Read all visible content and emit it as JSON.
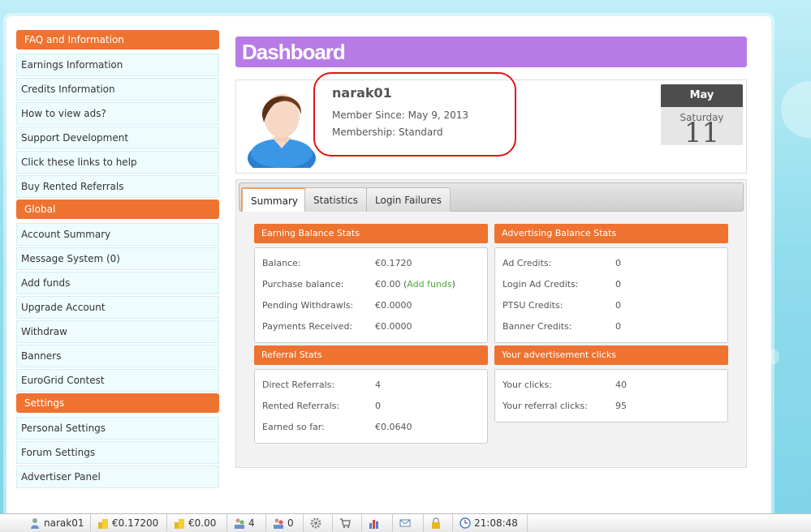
{
  "sidebar": {
    "faq_header": "FAQ and Information",
    "faq_items": [
      "Earnings Information",
      "Credits Information",
      "How to view ads?",
      "Support Development",
      "Click these links to help",
      "Buy Rented Referrals"
    ],
    "global_header": "Global",
    "global_items": [
      "Account Summary",
      "Message System (0)",
      "Add funds",
      "Upgrade Account",
      "Withdraw",
      "Banners",
      "EuroGrid Contest"
    ],
    "settings_header": "Settings",
    "settings_items": [
      "Personal Settings",
      "Forum Settings",
      "Advertiser Panel"
    ]
  },
  "dashboard": {
    "title": "Dashboard",
    "username": "narak01",
    "member_since": "Member Since: May 9, 2013",
    "membership": "Membership: Standard",
    "calendar": {
      "month": "May",
      "weekday": "Saturday",
      "day": "11"
    }
  },
  "tabs": [
    "Summary",
    "Statistics",
    "Login Failures"
  ],
  "earning": {
    "title": "Earning Balance Stats",
    "rows": [
      {
        "label": "Balance:",
        "value": "€0.1720"
      },
      {
        "label": "Purchase balance:",
        "value": "€0.00",
        "link": "Add funds"
      },
      {
        "label": "Pending Withdrawls:",
        "value": "€0.0000"
      },
      {
        "label": "Payments Received:",
        "value": "€0.0000"
      }
    ]
  },
  "advertising": {
    "title": "Advertising Balance Stats",
    "rows": [
      {
        "label": "Ad Credits:",
        "value": "0"
      },
      {
        "label": "Login Ad Credits:",
        "value": "0"
      },
      {
        "label": "PTSU Credits:",
        "value": "0"
      },
      {
        "label": "Banner Credits:",
        "value": "0"
      }
    ]
  },
  "referral": {
    "title": "Referral Stats",
    "rows": [
      {
        "label": "Direct Referrals:",
        "value": "4"
      },
      {
        "label": "Rented Referrals:",
        "value": "0"
      },
      {
        "label": "Earned so far:",
        "value": "€0.0640"
      }
    ]
  },
  "clicks": {
    "title": "Your advertisement clicks",
    "rows": [
      {
        "label": "Your clicks:",
        "value": "40"
      },
      {
        "label": "Your referral clicks:",
        "value": "95"
      }
    ]
  },
  "statusbar": {
    "user": "narak01",
    "balance": "€0.17200",
    "purchase": "€0.00",
    "direct": "4",
    "rented": "0",
    "time": "21:08:48"
  },
  "colors": {
    "orange": "#ee7330",
    "purple": "#b77be7",
    "highlight": "#e01616"
  }
}
